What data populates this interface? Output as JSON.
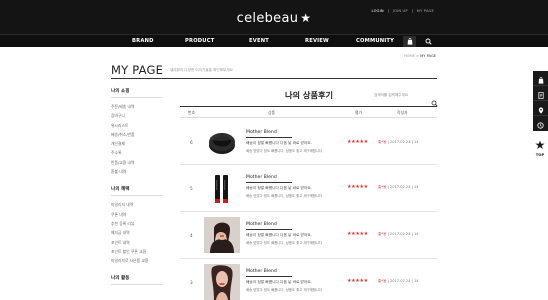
{
  "header": {
    "logo": "celebeau",
    "top_links": [
      "LOGIN",
      "JOIN UP",
      "MY PAGE"
    ],
    "nav": [
      "BRAND",
      "PRODUCT",
      "EVENT",
      "REVIEW",
      "COMMUNITY"
    ]
  },
  "page": {
    "title": "MY PAGE",
    "subtitle": "셀레뷰의 다양한 이야기들을 확인해보세요",
    "breadcrumb_home": "HOME",
    "breadcrumb_current": "MY PAGE"
  },
  "sidebar": {
    "groups": [
      {
        "title": "나의 쇼핑",
        "items": [
          "주문/배송 내역",
          "장바구니",
          "위시리스트",
          "배송/취소/반품",
          "개인결제",
          "주소록",
          "반품/교환 내역",
          "환불 내역"
        ]
      },
      {
        "title": "나의 혜택",
        "items": [
          "마일리지 내역",
          "쿠폰 내역",
          "추천 등록 리뷰",
          "예치금 내역",
          "포인트 내역",
          "포인트 할인 쿠폰 교환",
          "마일리지로 사은품 교환"
        ]
      },
      {
        "title": "나의 활동",
        "items": []
      }
    ]
  },
  "main": {
    "title": "나의 상품후기",
    "search_placeholder": "검색어를 입력해주세요",
    "columns": [
      "번호",
      "상품",
      "평가",
      "작성자"
    ]
  },
  "reviews": [
    {
      "num": "6",
      "brand": "Mother Blend",
      "text1": "배송이 정말 빠릅니다 다음 날 바로 받아요.",
      "text2": "배송 받았다 정도 빠릅니다, 상품도 좋고 재구매합니다",
      "stars": "★★★★★",
      "author": "홍*동",
      "date": "2017.02.24",
      "count": "14"
    },
    {
      "num": "5",
      "brand": "Mother Blend",
      "text1": "배송이 정말 빠릅니다 다음 날 바로 받아요.",
      "text2": "배송 받았다 정도 빠릅니다, 상품도 좋고 재구매합니다",
      "stars": "★★★★★",
      "author": "홍*동",
      "date": "2017.02.24",
      "count": "14"
    },
    {
      "num": "4",
      "brand": "Mother Blend",
      "text1": "배송이 정말 빠릅니다 다음 날 바로 받아요.",
      "text2": "배송 받았다 정도 빠릅니다, 상품도 좋고 재구매합니다",
      "stars": "★★★★★",
      "author": "홍*동",
      "date": "2017.02.24",
      "count": "14"
    },
    {
      "num": "3",
      "brand": "Mother Blend",
      "text1": "배송이 정말 빠릅니다 다음 날 바로 받아요.",
      "text2": "배송 받았다 정도 빠릅니다, 상품도 좋고 재구매합니다",
      "stars": "★★★★★",
      "author": "홍*동",
      "date": "2017.02.24",
      "count": "14"
    }
  ],
  "right_bar": {
    "top_label": "TOP"
  },
  "colors": {
    "header_bg": "#141414",
    "accent": "#e0302f"
  }
}
